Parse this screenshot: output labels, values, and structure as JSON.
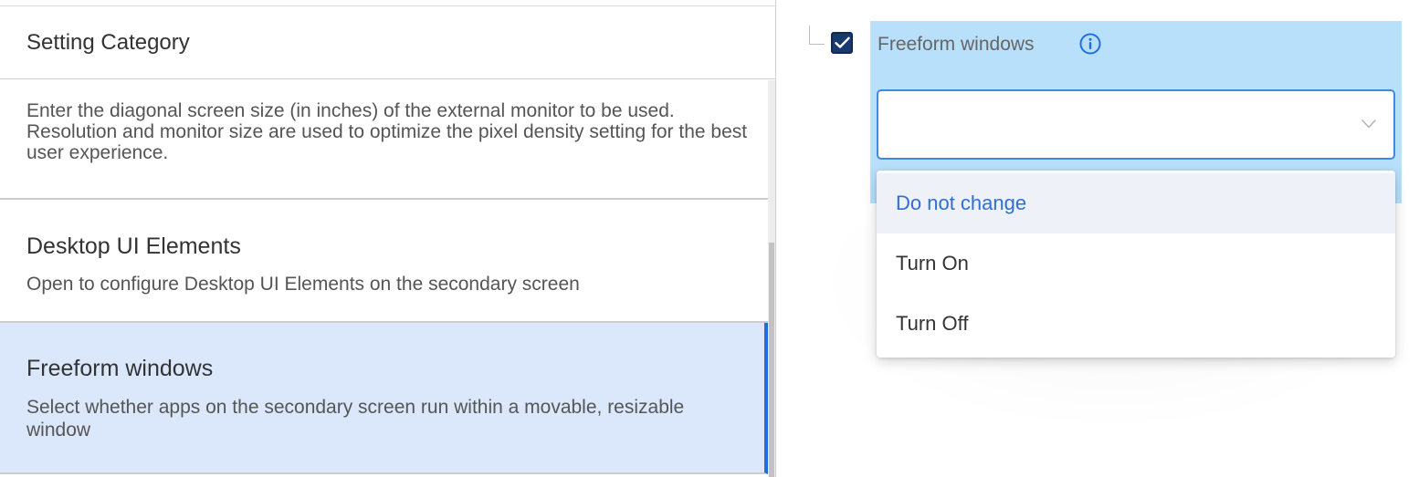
{
  "left_panel": {
    "header_title": "Setting Category",
    "categories": [
      {
        "title": "",
        "description": "Enter the diagonal screen size (in inches) of the external monitor to be used. Resolution and monitor size are used to optimize the pixel density setting for the best user experience."
      },
      {
        "title": "Desktop UI Elements",
        "description": "Open to configure Desktop UI Elements on the secondary screen"
      },
      {
        "title": "Freeform windows",
        "description": "Select whether apps on the secondary screen run within a movable, resizable window",
        "selected": true
      }
    ]
  },
  "right_panel": {
    "setting": {
      "label": "Freeform windows",
      "checked": true,
      "info_icon": "info-circle-icon",
      "dropdown_value": "",
      "chevron_icon": "chevron-down-icon",
      "options": [
        "Do not change",
        "Turn On",
        "Turn Off"
      ],
      "highlighted_option": "Do not change"
    }
  },
  "colors": {
    "accent": "#1e6fd9",
    "selected_category_bg": "#dbe8fb",
    "setting_highlight_bg": "#b8e0fb",
    "checkbox_fill": "#1a3a6e",
    "dropdown_border": "#3d8be0",
    "selected_option_text": "#2f6fd0"
  }
}
